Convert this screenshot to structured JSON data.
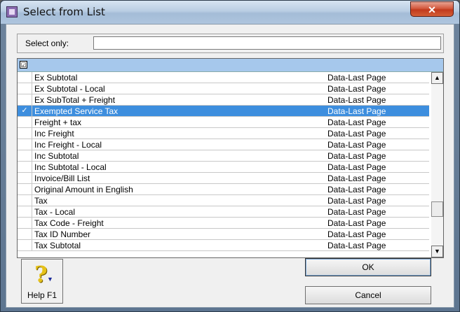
{
  "window": {
    "title": "Select from List",
    "close_glyph": "✕",
    "icon": "app-icon"
  },
  "filter": {
    "label": "Select only:",
    "value": ""
  },
  "list": {
    "header_check": "☑",
    "selected_index": 3,
    "rows": [
      {
        "name": "Ex Subtotal",
        "type": "Data-Last Page",
        "checked": false
      },
      {
        "name": "Ex Subtotal - Local",
        "type": "Data-Last Page",
        "checked": false
      },
      {
        "name": "Ex SubTotal + Freight",
        "type": "Data-Last Page",
        "checked": false
      },
      {
        "name": "Exempted Service Tax",
        "type": "Data-Last Page",
        "checked": true
      },
      {
        "name": "Freight + tax",
        "type": "Data-Last Page",
        "checked": false
      },
      {
        "name": "Inc Freight",
        "type": "Data-Last Page",
        "checked": false
      },
      {
        "name": "Inc Freight - Local",
        "type": "Data-Last Page",
        "checked": false
      },
      {
        "name": "Inc Subtotal",
        "type": "Data-Last Page",
        "checked": false
      },
      {
        "name": "Inc Subtotal - Local",
        "type": "Data-Last Page",
        "checked": false
      },
      {
        "name": "Invoice/Bill List",
        "type": "Data-Last Page",
        "checked": false
      },
      {
        "name": "Original Amount in English",
        "type": "Data-Last Page",
        "checked": false
      },
      {
        "name": "Tax",
        "type": "Data-Last Page",
        "checked": false
      },
      {
        "name": "Tax - Local",
        "type": "Data-Last Page",
        "checked": false
      },
      {
        "name": "Tax Code - Freight",
        "type": "Data-Last Page",
        "checked": false
      },
      {
        "name": "Tax ID Number",
        "type": "Data-Last Page",
        "checked": false
      },
      {
        "name": "Tax Subtotal",
        "type": "Data-Last Page",
        "checked": false
      }
    ],
    "check_glyph": "✓",
    "scroll_up_glyph": "▲",
    "scroll_down_glyph": "▼"
  },
  "buttons": {
    "help_label": "Help F1",
    "help_glyph": "?",
    "help_arrow_glyph": "▼",
    "ok_label": "OK",
    "cancel_label": "Cancel"
  },
  "colors": {
    "selection": "#3d8ede",
    "header": "#a6c8ec"
  }
}
